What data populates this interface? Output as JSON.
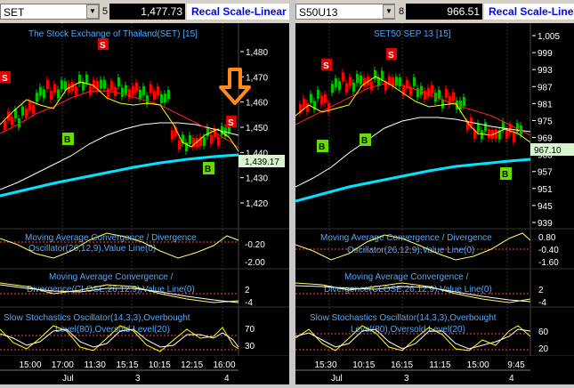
{
  "left": {
    "symbol": "SET",
    "field_digit": "5",
    "last_price": "1,477.73",
    "scale_button": "Recal Scale-Linear",
    "chart_title": "The Stock Exchange of Thailand(SET) [15]",
    "y_ticks": [
      "1,480",
      "1,470",
      "1,460",
      "1,450",
      "1,440",
      "1,430",
      "1,420"
    ],
    "current_price_label": "1,439.17",
    "macd_title": "Moving Average Convergence / Divergence",
    "macd_sub": "Oscillator(26,12,9),Value Line(0)",
    "macd_ticks": [
      "-0.20",
      "-2.00"
    ],
    "macd2_title": "Moving Average Convergence /",
    "macd2_sub": "Divergence(CLOSE,26,12,9),Value Line(0)",
    "macd2_ticks": [
      "2",
      "-4"
    ],
    "stoch_title": "Slow Stochastics Oscillator(14,3,3),Overbought",
    "stoch_sub": "Level(80),Oversold Level(20)",
    "stoch_ticks": [
      "70",
      "30"
    ],
    "time_labels": [
      "15:00",
      "17:00",
      "11:30",
      "15:15",
      "10:15",
      "12:15",
      "16:00"
    ],
    "date_labels": [
      "Jul",
      "3",
      "4"
    ],
    "signals": [
      "S",
      "S",
      "S",
      "B",
      "B"
    ]
  },
  "right": {
    "symbol": "S50U13",
    "field_digit": "8",
    "last_price": "966.51",
    "scale_button": "Recal Scale-Linear",
    "chart_title": "SET50 SEP 13   [15]",
    "y_ticks": [
      "1,005",
      "999",
      "993",
      "987",
      "981",
      "975",
      "969",
      "963",
      "957",
      "951",
      "945",
      "939"
    ],
    "current_price_label": "967.10",
    "macd_title": "Moving Average Convergence / Divergence",
    "macd_sub": "Oscillator(26,12,9),Value Line(0)",
    "macd_ticks": [
      "0.80",
      "-0.40",
      "-1.60"
    ],
    "macd2_title": "Moving Average Convergence /",
    "macd2_sub": "Divergence(CLOSE,26,12,9),Value Line(0)",
    "macd2_ticks": [
      "2",
      "-4"
    ],
    "stoch_title": "Slow Stochastics Oscillator(14,3,3),Overbought",
    "stoch_sub": "Level(80),Oversold Level(20)",
    "stoch_ticks": [
      "60",
      "20"
    ],
    "time_labels": [
      "15:30",
      "10:15",
      "16:15",
      "11:15",
      "15:00",
      "9:45"
    ],
    "date_labels": [
      "Jul",
      "3",
      "4"
    ],
    "signals": [
      "S",
      "S",
      "B",
      "B",
      "B"
    ]
  },
  "colors": {
    "background": "#000000",
    "up_candle": "#00c000",
    "down_candle": "#ff0000",
    "ma_fast": "#ffff00",
    "ma_mid": "#ff0000",
    "ma_slow": "#ffffff",
    "ma_long": "#00e5ff",
    "sell_marker": "#e00000",
    "buy_marker": "#66dd00",
    "arrow": "#ff8c1a",
    "price_tag": "#d8f5d0"
  }
}
